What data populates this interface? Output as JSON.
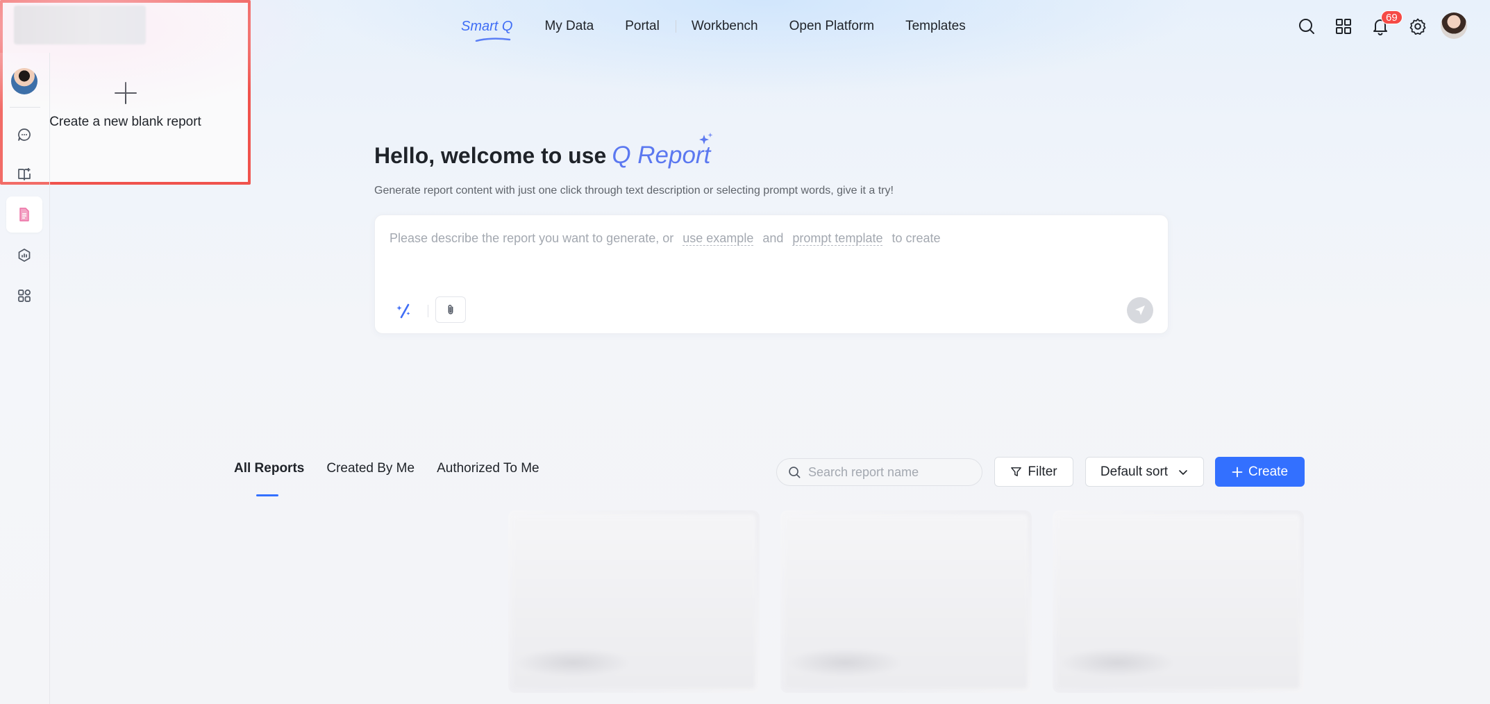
{
  "topnav": {
    "brand": "Smart Q",
    "items": [
      "My Data",
      "Portal",
      "Workbench",
      "Open Platform",
      "Templates"
    ]
  },
  "header_icons": [
    "search-icon",
    "apps-grid-icon",
    "bell-icon",
    "gear-icon",
    "user-avatar"
  ],
  "notifications": {
    "count": "69"
  },
  "sidebar": {
    "items": [
      {
        "name": "chat-icon"
      },
      {
        "name": "book-icon"
      },
      {
        "name": "report-icon",
        "active": true
      },
      {
        "name": "analysis-icon"
      },
      {
        "name": "apps-icon"
      }
    ]
  },
  "hero": {
    "title": "Hello, welcome to use",
    "brand": "Q Report",
    "subtitle": "Generate report content with just one click through text description or selecting prompt words, give it a try!"
  },
  "prompt": {
    "text_before": "Please describe the report you want to generate, or",
    "link_example": "use example",
    "text_and": "and",
    "link_template": "prompt template",
    "text_after": "to create"
  },
  "tabs": [
    {
      "label": "All Reports",
      "active": true
    },
    {
      "label": "Created By Me"
    },
    {
      "label": "Authorized To Me"
    }
  ],
  "toolbar": {
    "search_placeholder": "Search report name",
    "filter_label": "Filter",
    "sort_label": "Default sort",
    "create_label": "Create"
  },
  "cards": {
    "new_label": "Create a new blank report"
  },
  "colors": {
    "accent": "#3370ff",
    "brand": "#5b78f0",
    "badge": "#f54a45",
    "highlight_border": "#f0534d"
  }
}
